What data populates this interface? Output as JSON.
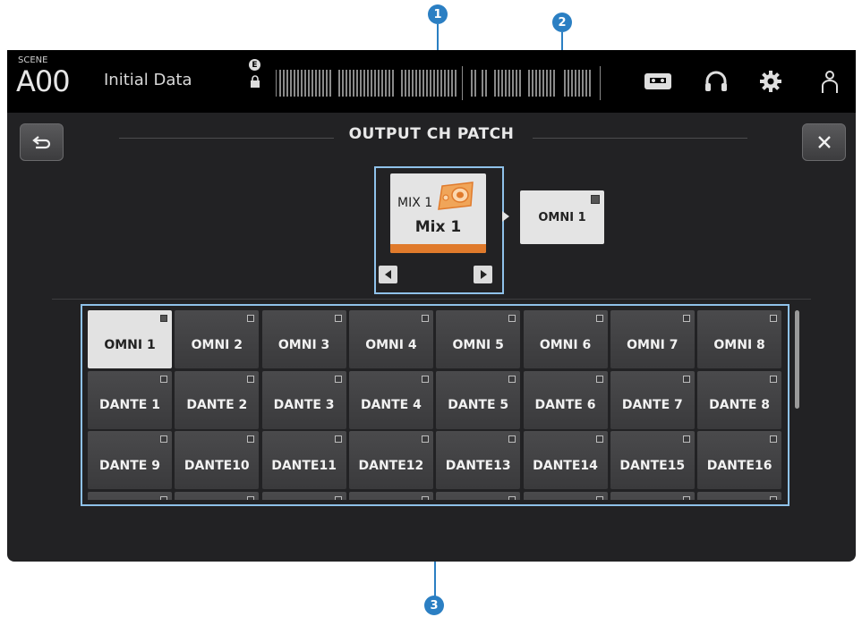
{
  "callouts": [
    "1",
    "2",
    "3"
  ],
  "topbar": {
    "scene_label": "SCENE",
    "scene_number": "A00",
    "scene_name": "Initial Data",
    "edit_badge": "E"
  },
  "panel": {
    "title": "OUTPUT CH PATCH"
  },
  "source": {
    "channel": "MIX 1",
    "name": "Mix 1",
    "bar_color": "#e07a2b"
  },
  "destination": {
    "label": "OMNI 1"
  },
  "ports": [
    "OMNI 1",
    "OMNI 2",
    "OMNI 3",
    "OMNI 4",
    "OMNI 5",
    "OMNI 6",
    "OMNI 7",
    "OMNI 8",
    "DANTE 1",
    "DANTE 2",
    "DANTE 3",
    "DANTE 4",
    "DANTE 5",
    "DANTE 6",
    "DANTE 7",
    "DANTE 8",
    "DANTE 9",
    "DANTE10",
    "DANTE11",
    "DANTE12",
    "DANTE13",
    "DANTE14",
    "DANTE15",
    "DANTE16"
  ],
  "selected_port": "OMNI 1",
  "colors": {
    "accent": "#2b7fc3",
    "highlight": "#8fc2ea",
    "mix_orange": "#e07a2b"
  }
}
